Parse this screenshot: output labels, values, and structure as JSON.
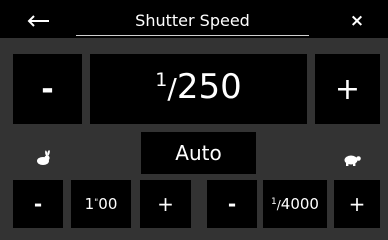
{
  "header": {
    "back_icon": "left-arrow-icon",
    "title": "Shutter Speed",
    "close_label": "×"
  },
  "main_control": {
    "minus_label": "-",
    "value_numerator": "1",
    "value_denominator": "250",
    "plus_label": "+"
  },
  "mode": {
    "label": "Auto",
    "slow_icon": "rabbit-icon",
    "fast_icon": "turtle-icon"
  },
  "limits": {
    "min": {
      "minus_label": "-",
      "value_whole": "1",
      "value_fraction": "00",
      "plus_label": "+"
    },
    "max": {
      "minus_label": "-",
      "value_numerator": "1",
      "value_denominator": "4000",
      "plus_label": "+"
    }
  },
  "colors": {
    "background": "#333333",
    "tile": "#000000",
    "text": "#ffffff"
  }
}
